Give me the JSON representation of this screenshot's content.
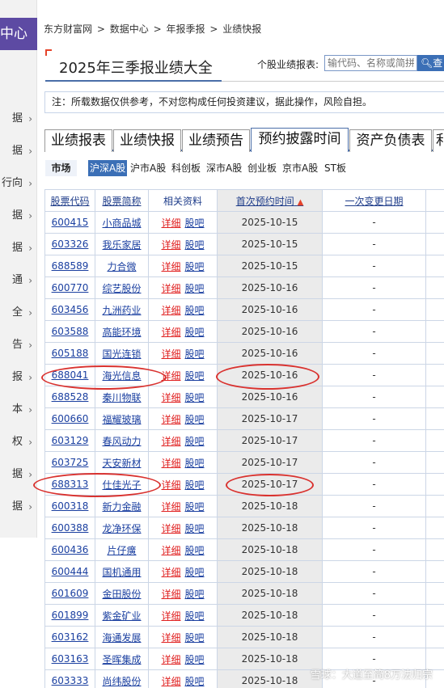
{
  "sidebar": {
    "head": "中心",
    "items": [
      "据",
      "据",
      "行向",
      "据",
      "据",
      "通",
      "全",
      "告",
      "报",
      "本",
      "权",
      "据",
      "据"
    ]
  },
  "breadcrumb": [
    "东方财富网",
    ">",
    "数据中心",
    ">",
    "年报季报",
    ">",
    "业绩快报"
  ],
  "page_title": "2025年三季报业绩大全",
  "search": {
    "label": "个股业绩报表:",
    "placeholder": "输代码、名称或简拼",
    "button": "查"
  },
  "notice": "注：所载数据仅供参考，不对您构成任何投资建议，据此操作，风险自担。",
  "tabs": [
    "业绩报表",
    "业绩快报",
    "业绩预告",
    "预约披露时间",
    "资产负债表",
    "利"
  ],
  "active_tab": "预约披露时间",
  "market": {
    "label": "市场",
    "options": [
      "沪深A股",
      "沪市A股",
      "科创板",
      "深市A股",
      "创业板",
      "京市A股",
      "ST板"
    ],
    "active": "沪深A股"
  },
  "table": {
    "headers": [
      "股票代码",
      "股票简称",
      "相关资料",
      "首次预约时间",
      "一次变更日期"
    ],
    "link_detail": "详细",
    "link_forum": "股吧",
    "rows": [
      {
        "code": "600415",
        "name": "小商品城",
        "date": "2025-10-15",
        "change": "-"
      },
      {
        "code": "603326",
        "name": "我乐家居",
        "date": "2025-10-15",
        "change": "-"
      },
      {
        "code": "688589",
        "name": "力合微",
        "date": "2025-10-15",
        "change": "-"
      },
      {
        "code": "600770",
        "name": "综艺股份",
        "date": "2025-10-16",
        "change": "-"
      },
      {
        "code": "603456",
        "name": "九洲药业",
        "date": "2025-10-16",
        "change": "-"
      },
      {
        "code": "603588",
        "name": "高能环境",
        "date": "2025-10-16",
        "change": "-"
      },
      {
        "code": "605188",
        "name": "国光连锁",
        "date": "2025-10-16",
        "change": "-"
      },
      {
        "code": "688041",
        "name": "海光信息",
        "date": "2025-10-16",
        "change": "-"
      },
      {
        "code": "688528",
        "name": "秦川物联",
        "date": "2025-10-16",
        "change": "-"
      },
      {
        "code": "600660",
        "name": "福耀玻璃",
        "date": "2025-10-17",
        "change": "-"
      },
      {
        "code": "603129",
        "name": "春风动力",
        "date": "2025-10-17",
        "change": "-"
      },
      {
        "code": "603725",
        "name": "天安新材",
        "date": "2025-10-17",
        "change": "-"
      },
      {
        "code": "688313",
        "name": "仕佳光子",
        "date": "2025-10-17",
        "change": "-"
      },
      {
        "code": "600318",
        "name": "新力金融",
        "date": "2025-10-18",
        "change": "-"
      },
      {
        "code": "600388",
        "name": "龙净环保",
        "date": "2025-10-18",
        "change": "-"
      },
      {
        "code": "600436",
        "name": "片仔癀",
        "date": "2025-10-18",
        "change": "-"
      },
      {
        "code": "600444",
        "name": "国机通用",
        "date": "2025-10-18",
        "change": "-"
      },
      {
        "code": "601609",
        "name": "金田股份",
        "date": "2025-10-18",
        "change": "-"
      },
      {
        "code": "601899",
        "name": "紫金矿业",
        "date": "2025-10-18",
        "change": "-"
      },
      {
        "code": "603162",
        "name": "海通发展",
        "date": "2025-10-18",
        "change": "-"
      },
      {
        "code": "603163",
        "name": "圣晖集成",
        "date": "2025-10-18",
        "change": "-"
      },
      {
        "code": "603333",
        "name": "尚纬股份",
        "date": "2025-10-18",
        "change": "-"
      }
    ]
  },
  "watermark": "雪球：大道至简8万法归宗",
  "colors": {
    "accent": "#3b6fb6",
    "title_corner": "#e5432a",
    "sidebar_head": "#5d4aa3",
    "link_red": "#e02020",
    "annotation": "#d9322f"
  }
}
